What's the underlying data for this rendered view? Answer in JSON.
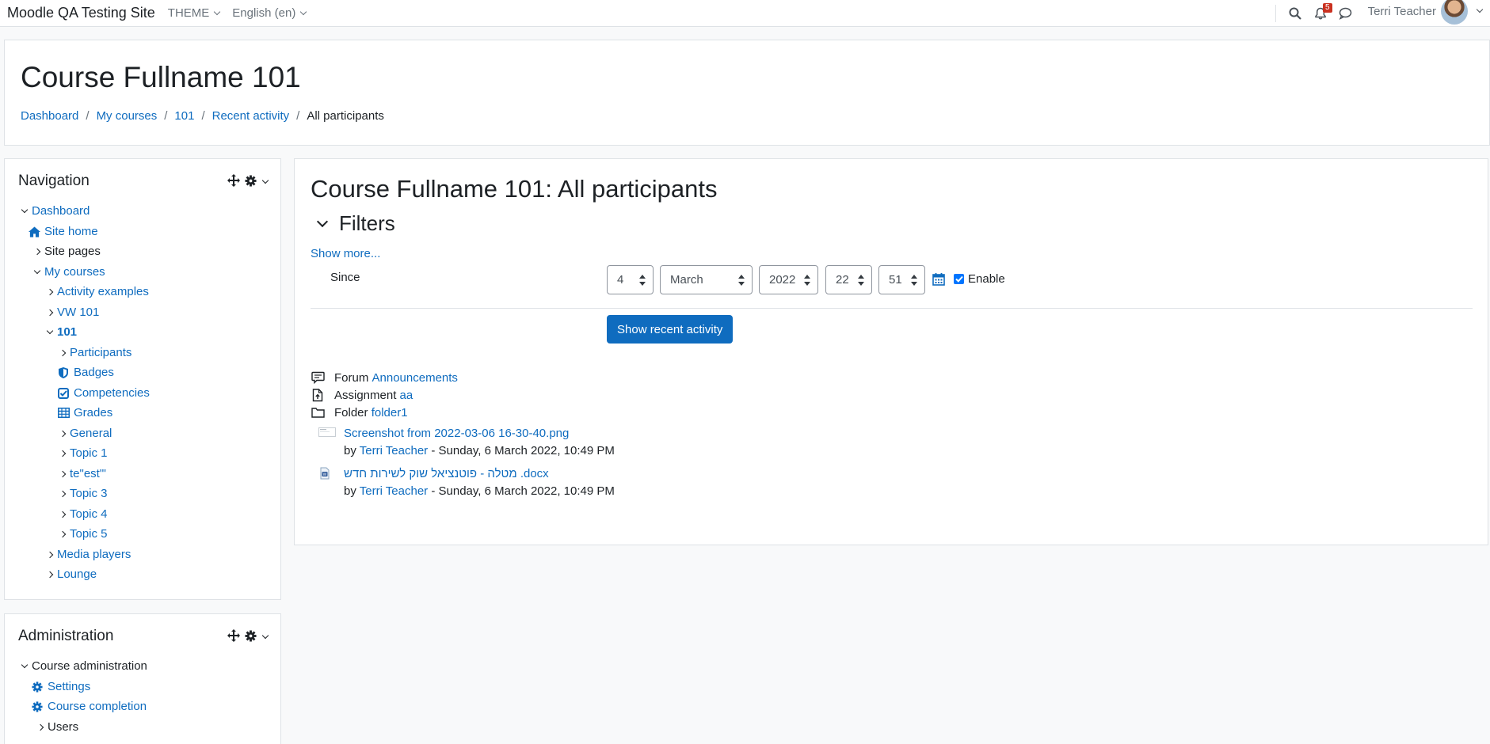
{
  "navbar": {
    "site_name": "Moodle QA Testing Site",
    "theme_menu": "THEME",
    "language_menu": "English (en)",
    "notification_count": "5",
    "user_name": "Terri Teacher"
  },
  "header": {
    "title": "Course Fullname 101",
    "breadcrumb": [
      "Dashboard",
      "My courses",
      "101",
      "Recent activity",
      "All participants"
    ]
  },
  "navigation": {
    "title": "Navigation",
    "items": [
      {
        "label": "Dashboard"
      },
      {
        "label": "Site home"
      },
      {
        "label": "Site pages"
      },
      {
        "label": "My courses"
      },
      {
        "label": "Activity examples"
      },
      {
        "label": "VW 101"
      },
      {
        "label": "101"
      },
      {
        "label": "Participants"
      },
      {
        "label": "Badges"
      },
      {
        "label": "Competencies"
      },
      {
        "label": "Grades"
      },
      {
        "label": "General"
      },
      {
        "label": "Topic 1"
      },
      {
        "label": "te\"est\"'"
      },
      {
        "label": "Topic 3"
      },
      {
        "label": "Topic 4"
      },
      {
        "label": "Topic 5"
      },
      {
        "label": "Media players"
      },
      {
        "label": "Lounge"
      }
    ]
  },
  "administration": {
    "title": "Administration",
    "items": [
      {
        "label": "Course administration"
      },
      {
        "label": "Settings"
      },
      {
        "label": "Course completion"
      },
      {
        "label": "Users"
      }
    ]
  },
  "main": {
    "title": "Course Fullname 101: All participants",
    "filters_label": "Filters",
    "show_more": "Show more...",
    "since_label": "Since",
    "since": {
      "day": "4",
      "month": "March",
      "year": "2022",
      "hour": "22",
      "minute": "51"
    },
    "enable_label": "Enable",
    "show_button": "Show recent activity",
    "activities": [
      {
        "type": "Forum",
        "name": "Announcements"
      },
      {
        "type": "Assignment",
        "name": "aa"
      },
      {
        "type": "Folder",
        "name": "folder1"
      }
    ],
    "files": [
      {
        "name": "Screenshot from 2022-03-06 16-30-40.png",
        "by": "by",
        "author": "Terri Teacher",
        "date": "- Sunday, 6 March 2022, 10:49 PM"
      },
      {
        "name": "מטלה - פוטנציאל שוק לשירות חדש .docx",
        "by": "by",
        "author": "Terri Teacher",
        "date": "- Sunday, 6 March 2022, 10:49 PM"
      }
    ]
  },
  "colors": {
    "link": "#0f6cbf",
    "primary": "#0f6cbf",
    "badge": "#ca3120"
  }
}
